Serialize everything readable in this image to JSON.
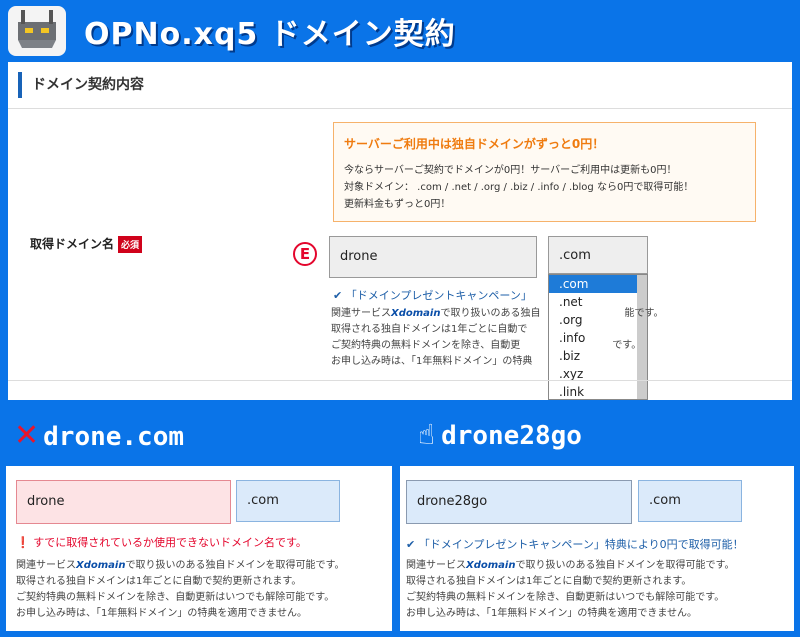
{
  "header": {
    "title": "OPNo.xq5 ドメイン契約"
  },
  "section": {
    "heading": "ドメイン契約内容"
  },
  "promo": {
    "title": "サーバーご利用中は独自ドメインがずっと0円！",
    "line1": "今ならサーバーご契約でドメインが0円！サーバーご利用中は更新も0円！",
    "line2": "対象ドメイン： .com / .net / .org / .biz / .info / .blog なら0円で取得可能！",
    "line3": "更新料金もずっと0円！"
  },
  "form": {
    "label": "取得ドメイン名",
    "required_badge": "必須",
    "marker": "E",
    "domain_value": "drone",
    "tld_value": ".com",
    "tld_options": [
      ".com",
      ".net",
      ".org",
      ".info",
      ".biz",
      ".xyz",
      ".link"
    ],
    "campaign": "「ドメインプレゼントキャンペーン」",
    "note_line1_prefix": "関連サービス",
    "xdomain": "Xdomain",
    "note_line1_suffix": "で取り扱いのある独自",
    "note_line1_tail": "能です。",
    "note_line2": "取得される独自ドメインは1年ごとに自動で",
    "note_line3": "ご契約特典の無料ドメインを除き、自動更",
    "note_line3_tail": "です。",
    "note_line4": "お申し込み時は、「1年無料ドメイン」の特典"
  },
  "captions": {
    "bad_mark": "✕",
    "bad": "drone.com",
    "good_mark": "☝",
    "good": "drone28go"
  },
  "card_bad": {
    "domain_value": "drone",
    "tld_value": ".com",
    "error": "❗ すでに取得されているか使用できないドメイン名です。",
    "note_line1_prefix": "関連サービス",
    "xdomain": "Xdomain",
    "note_line1_suffix": "で取り扱いのある独自ドメインを取得可能です。",
    "note_line2": "取得される独自ドメインは1年ごとに自動で契約更新されます。",
    "note_line3": "ご契約特典の無料ドメインを除き、自動更新はいつでも解除可能です。",
    "note_line4": "お申し込み時は、「1年無料ドメイン」の特典を適用できません。"
  },
  "card_good": {
    "domain_value": "drone28go",
    "tld_value": ".com",
    "success": "✔ 「ドメインプレゼントキャンペーン」特典により0円で取得可能！",
    "note_line1_prefix": "関連サービス",
    "xdomain": "Xdomain",
    "note_line1_suffix": "で取り扱いのある独自ドメインを取得可能です。",
    "note_line2": "取得される独自ドメインは1年ごとに自動で契約更新されます。",
    "note_line3": "ご契約特典の無料ドメインを除き、自動更新はいつでも解除可能です。",
    "note_line4": "お申し込み時は、「1年無料ドメイン」の特典を適用できません。"
  },
  "colors": {
    "banner_blue": "#0a74e8",
    "promo_orange": "#ef7b0f",
    "error_red": "#e4062d",
    "link_blue": "#1e5fa8",
    "selected_blue": "#1e7bd8"
  },
  "icons": {
    "logo": "server-logo-icon",
    "check": "check-icon",
    "error": "error-icon",
    "ok_hand": "hand-ok-icon"
  }
}
